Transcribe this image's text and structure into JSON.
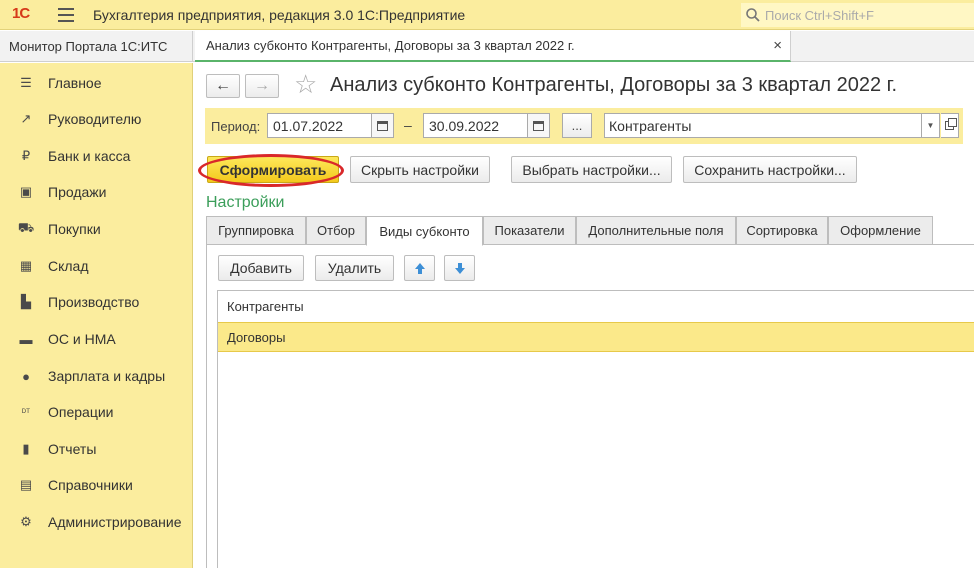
{
  "app": {
    "logo_text": "1С",
    "title": "Бухгалтерия предприятия, редакция 3.0 1С:Предприятие",
    "search_placeholder": "Поиск Ctrl+Shift+F"
  },
  "tabs": {
    "home_label": "Монитор Портала 1С:ИТС",
    "doc_label": "Анализ субконто Контрагенты, Договоры за 3 квартал 2022 г.",
    "close_glyph": "×"
  },
  "sidebar": {
    "items": [
      {
        "label": "Главное",
        "icon": "menu-icon",
        "glyph": "☰"
      },
      {
        "label": "Руководителю",
        "icon": "trend-icon",
        "glyph": "↗"
      },
      {
        "label": "Банк и касса",
        "icon": "coin-icon",
        "glyph": "₽"
      },
      {
        "label": "Продажи",
        "icon": "bag-icon",
        "glyph": "▣"
      },
      {
        "label": "Покупки",
        "icon": "cart-icon",
        "glyph": "⛟"
      },
      {
        "label": "Склад",
        "icon": "warehouse-icon",
        "glyph": "▦"
      },
      {
        "label": "Производство",
        "icon": "factory-icon",
        "glyph": "▙"
      },
      {
        "label": "ОС и НМА",
        "icon": "truck-icon",
        "glyph": "▬"
      },
      {
        "label": "Зарплата и кадры",
        "icon": "person-icon",
        "glyph": "●"
      },
      {
        "label": "Операции",
        "icon": "dt-kt-icon",
        "glyph": "ᴰᵀ"
      },
      {
        "label": "Отчеты",
        "icon": "bar-chart-icon",
        "glyph": "▮"
      },
      {
        "label": "Справочники",
        "icon": "books-icon",
        "glyph": "▤"
      },
      {
        "label": "Администрирование",
        "icon": "gear-icon",
        "glyph": "⚙"
      }
    ]
  },
  "header": {
    "back_glyph": "←",
    "forward_glyph": "→",
    "star_glyph": "☆",
    "title": "Анализ субконто Контрагенты, Договоры за 3 квартал 2022 г."
  },
  "period": {
    "label": "Период:",
    "date_from": "01.07.2022",
    "date_to": "30.09.2022",
    "dash": "–",
    "dots_label": "...",
    "subconto_value": "Контрагенты",
    "dropdown_glyph": "▼"
  },
  "actions": {
    "generate": "Сформировать",
    "hide_settings": "Скрыть настройки",
    "choose_settings": "Выбрать настройки...",
    "save_settings": "Сохранить настройки..."
  },
  "settings": {
    "title": "Настройки",
    "tabs": [
      "Группировка",
      "Отбор",
      "Виды субконто",
      "Показатели",
      "Дополнительные поля",
      "Сортировка",
      "Оформление"
    ],
    "active_tab": "Виды субконто",
    "add": "Добавить",
    "delete": "Удалить",
    "up_glyph": "🡅",
    "down_glyph": "🡇",
    "rows": [
      {
        "label": "Контрагенты",
        "selected": false
      },
      {
        "label": "Договоры",
        "selected": true
      }
    ]
  },
  "colors": {
    "accent_yellow": "#fbed9e",
    "primary_button": "#f3c91c",
    "section_green": "#3b9e5a",
    "highlight_red": "#d9282a",
    "arrow_blue": "#3d8fd6"
  }
}
